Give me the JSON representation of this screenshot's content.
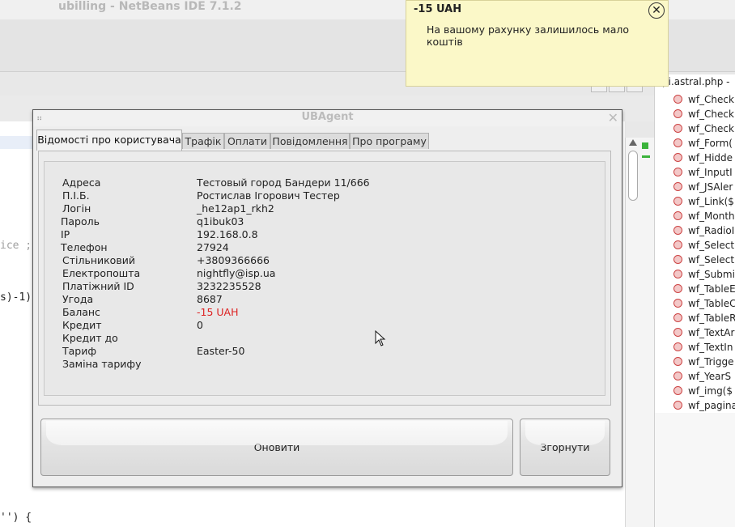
{
  "ide": {
    "title": "ubilling - NetBeans IDE 7.1.2",
    "code_fragments": [
      "ice ;",
      "s)-1)",
      "'') {"
    ],
    "navigator": {
      "title": "pi.astral.php -",
      "items": [
        "wf_Check",
        "wf_Check",
        "wf_Check",
        "wf_Form(",
        "wf_Hidde",
        "wf_InputI",
        "wf_JSAler",
        "wf_Link($",
        "wf_Month",
        "wf_RadioI",
        "wf_Select",
        "wf_Select",
        "wf_Submi",
        "wf_TableE",
        "wf_TableC",
        "wf_TableR",
        "wf_TextAr",
        "wf_TextIn",
        "wf_Trigge",
        "wf_YearS",
        "wf_img($",
        "wf_pagina"
      ]
    }
  },
  "notification": {
    "title": "-15 UAH",
    "message": "На вашому рахунку залишилось мало коштів",
    "close_glyph": "✕"
  },
  "window": {
    "title": "UBAgent",
    "close_glyph": "✕",
    "tabs": [
      "Відомості про користувача",
      "Трафік",
      "Оплати",
      "Повідомлення",
      "Про програму"
    ],
    "active_tab": 0,
    "fields": [
      {
        "label": "Адреса",
        "value": "Тестовый город Бандери 11/666"
      },
      {
        "label": "П.І.Б.",
        "value": "Ростислав Ігорович Тестер"
      },
      {
        "label": "Логін",
        "value": "_he12ap1_rkh2"
      },
      {
        "label": "Пароль",
        "value": "q1ibuk03"
      },
      {
        "label": "IP",
        "value": "192.168.0.8"
      },
      {
        "label": "Телефон",
        "value": "27924"
      },
      {
        "label": "Стільниковий",
        "value": "+3809366666"
      },
      {
        "label": "Електропошта",
        "value": "nightfly@isp.ua"
      },
      {
        "label": "Платіжний ID",
        "value": "3232235528"
      },
      {
        "label": "Угода",
        "value": "8687"
      },
      {
        "label": "Баланс",
        "value": "-15 UAH"
      },
      {
        "label": "Кредит",
        "value": "0"
      },
      {
        "label": "Кредит до",
        "value": ""
      },
      {
        "label": "Тариф",
        "value": "Easter-50"
      },
      {
        "label": "Заміна тарифу",
        "value": ""
      }
    ],
    "balance_color": "#dd2222",
    "buttons": {
      "refresh": "Оновити",
      "minimize": "Згорнути"
    }
  }
}
